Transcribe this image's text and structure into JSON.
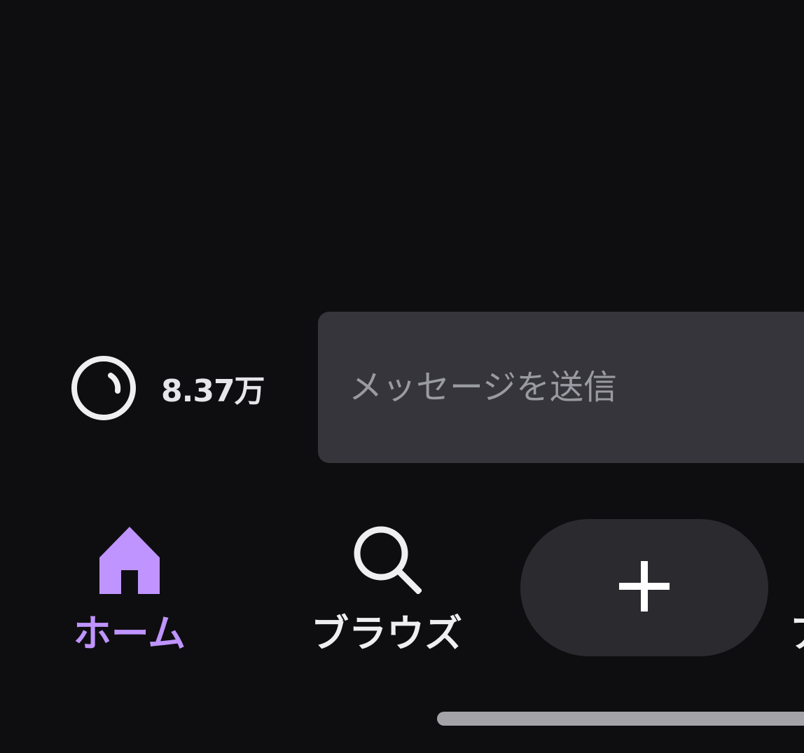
{
  "chat": {
    "points_value": "8.37万",
    "input_placeholder": "メッセージを送信"
  },
  "nav": {
    "home_label": "ホーム",
    "browse_label": "ブラウズ",
    "truncated_label": "ア"
  },
  "colors": {
    "background": "#0e0e10",
    "accent": "#bf94ff",
    "input_bg": "#35353b",
    "create_bg": "#2a2a2f"
  }
}
